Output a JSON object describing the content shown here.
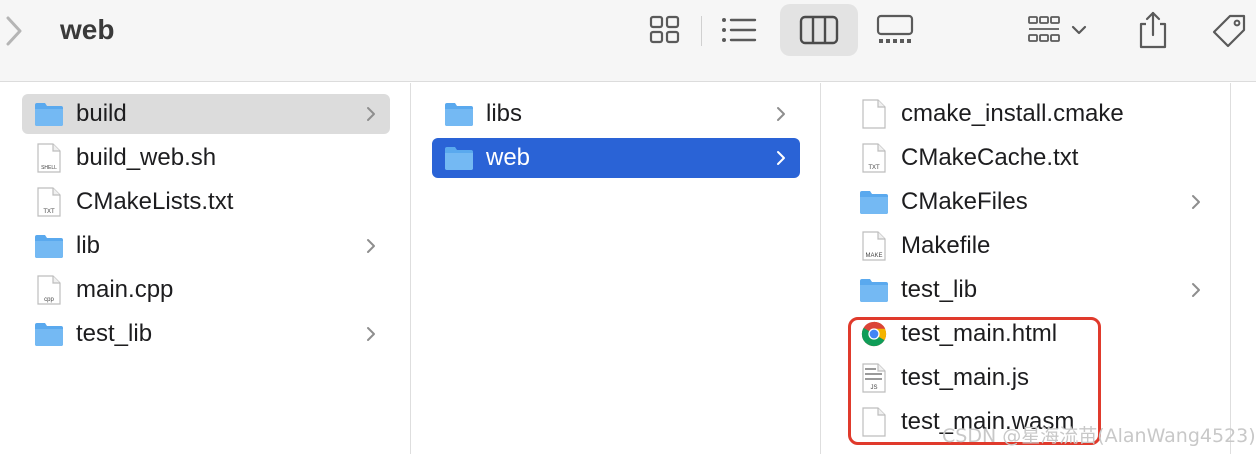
{
  "window": {
    "title": "web"
  },
  "toolbar": {
    "buttons": [
      {
        "name": "icon-view-button",
        "icon": "grid-icon"
      },
      {
        "name": "list-view-button",
        "icon": "list-icon"
      },
      {
        "name": "column-view-button",
        "icon": "columns-icon",
        "active": true
      },
      {
        "name": "gallery-view-button",
        "icon": "gallery-icon"
      },
      {
        "name": "group-button",
        "icon": "group-icon"
      },
      {
        "name": "share-button",
        "icon": "share-icon"
      },
      {
        "name": "tag-button",
        "icon": "tag-icon"
      }
    ]
  },
  "columns": [
    {
      "items": [
        {
          "label": "build",
          "kind": "folder",
          "chevron": true,
          "selected": "gray"
        },
        {
          "label": "build_web.sh",
          "kind": "file",
          "badge": "SHELL"
        },
        {
          "label": "CMakeLists.txt",
          "kind": "file",
          "badge": "TXT"
        },
        {
          "label": "lib",
          "kind": "folder",
          "chevron": true
        },
        {
          "label": "main.cpp",
          "kind": "file",
          "badge": "cpp"
        },
        {
          "label": "test_lib",
          "kind": "folder",
          "chevron": true
        }
      ]
    },
    {
      "items": [
        {
          "label": "libs",
          "kind": "folder",
          "chevron": true
        },
        {
          "label": "web",
          "kind": "folder",
          "chevron": true,
          "selected": "blue"
        }
      ]
    },
    {
      "items": [
        {
          "label": "cmake_install.cmake",
          "kind": "file",
          "badge": ""
        },
        {
          "label": "CMakeCache.txt",
          "kind": "file",
          "badge": "TXT"
        },
        {
          "label": "CMakeFiles",
          "kind": "folder",
          "chevron": true
        },
        {
          "label": "Makefile",
          "kind": "file",
          "badge": "MAKE"
        },
        {
          "label": "test_lib",
          "kind": "folder",
          "chevron": true
        },
        {
          "label": "test_main.html",
          "kind": "chrome"
        },
        {
          "label": "test_main.js",
          "kind": "file",
          "badge": "JS"
        },
        {
          "label": "test_main.wasm",
          "kind": "file",
          "badge": ""
        }
      ]
    }
  ],
  "watermark": "CSDN @星海流苗(AlanWang4523)",
  "colors": {
    "selection_blue": "#2a63d6",
    "folder_blue": "#5aa9ee",
    "highlight_red": "#e03a2c"
  }
}
